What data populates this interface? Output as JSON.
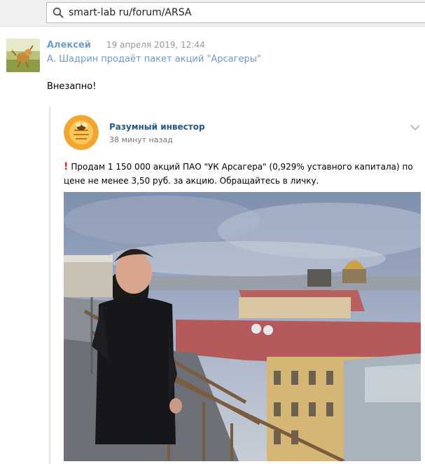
{
  "search": {
    "value": "smart-lab ru/forum/ARSA",
    "icon": "search-icon"
  },
  "post": {
    "author": "Алексей",
    "date": "19 апреля 2019, 12:44",
    "link_text": "А. Шадрин продаёт пакет акций \"Арсагеры\"",
    "text": "Внезапно!"
  },
  "repost": {
    "source_name": "Разумный инвестор",
    "time_ago": "38 минут назад",
    "text_line1": "Продам 1 150 000 акций ПАО \"УК Арсагера\" (0,929% уставного капитала) по",
    "text_line2": "цене не менее 3,50 руб. за акцию. Обращайтесь в личку."
  },
  "colors": {
    "link": "#6d99c8",
    "author": "#6f9ccc",
    "source_name": "#2a5885",
    "exclamation": "#d5222b"
  }
}
